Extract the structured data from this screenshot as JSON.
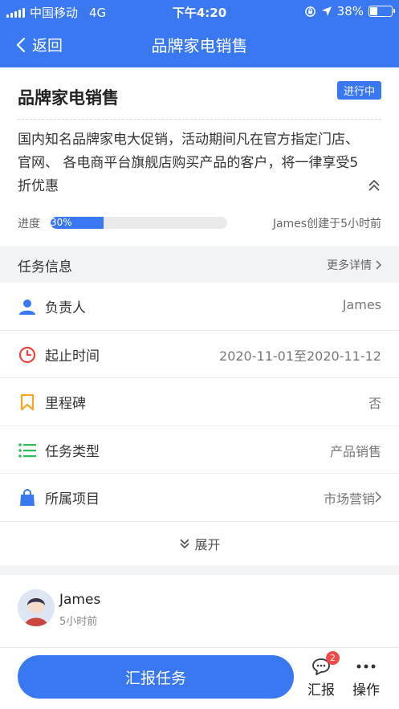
{
  "status_bar": {
    "carrier": "中国移动",
    "network": "4G",
    "time": "下午4:20",
    "battery": "38%",
    "battery_level": 0.38
  },
  "nav": {
    "back_label": "返回",
    "title": "品牌家电销售"
  },
  "task": {
    "title": "品牌家电销售",
    "status": "进行中",
    "description": "国内知名品牌家电大促销，活动期间凡在官方指定门店、 官网、 各电商平台旗舰店购买产品的客户，将一律享受5折优惠",
    "progress_label": "进度",
    "progress_value": 0.3,
    "progress_text": "30%",
    "created_info": "James创建于5小时前"
  },
  "section": {
    "title": "任务信息",
    "more_label": "更多详情"
  },
  "info_rows": [
    {
      "icon": "person-icon",
      "label": "负责人",
      "value": "James",
      "arrow": false
    },
    {
      "icon": "clock-icon",
      "label": "起止时间",
      "value": "2020-11-01至2020-11-12",
      "arrow": false
    },
    {
      "icon": "bookmark-icon",
      "label": "里程碑",
      "value": "否",
      "arrow": false
    },
    {
      "icon": "list-icon",
      "label": "任务类型",
      "value": "产品销售",
      "arrow": false
    },
    {
      "icon": "bag-icon",
      "label": "所属项目",
      "value": "市场营销",
      "arrow": true
    }
  ],
  "expand_label": "展开",
  "activity": {
    "name": "James",
    "time": "5小时前"
  },
  "bottom": {
    "report_button": "汇报任务",
    "report_tab": "汇报",
    "report_badge": "2",
    "ops_tab": "操作"
  },
  "colors": {
    "primary": "#3a78f2",
    "badge_red": "#f24848",
    "clock_red": "#e8463c",
    "bookmark_orange": "#f5a623",
    "list_green": "#2ebd59"
  }
}
